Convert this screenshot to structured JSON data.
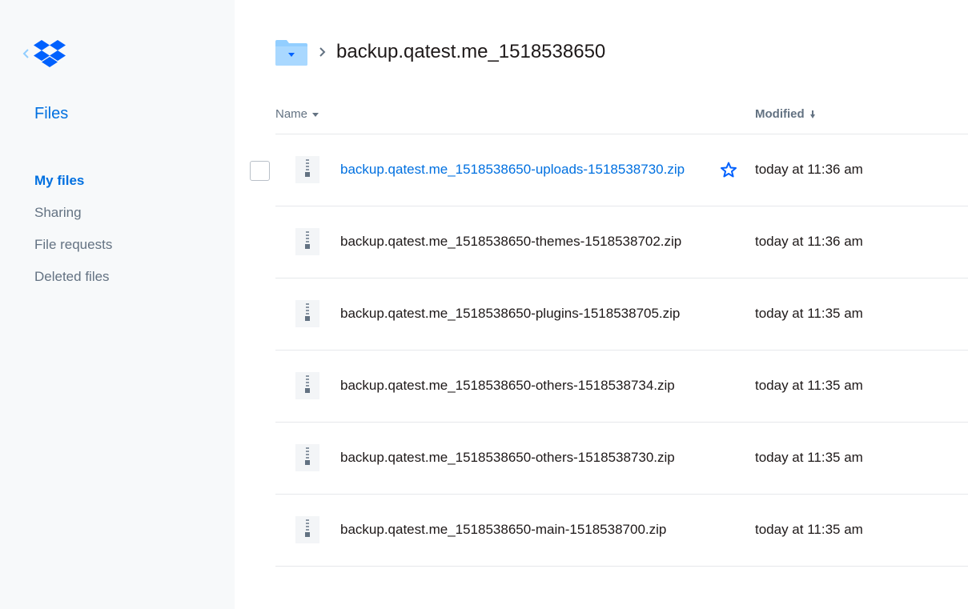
{
  "sidebar": {
    "title": "Files",
    "nav": [
      {
        "label": "My files",
        "active": true
      },
      {
        "label": "Sharing",
        "active": false
      },
      {
        "label": "File requests",
        "active": false
      },
      {
        "label": "Deleted files",
        "active": false
      }
    ]
  },
  "breadcrumb": {
    "folder_icon": "folder-icon",
    "current": "backup.qatest.me_1518538650"
  },
  "table": {
    "col_name": "Name",
    "col_modified": "Modified",
    "files": [
      {
        "name": "backup.qatest.me_1518538650-uploads-1518538730.zip",
        "modified": "today at 11:36 am",
        "hover": true
      },
      {
        "name": "backup.qatest.me_1518538650-themes-1518538702.zip",
        "modified": "today at 11:36 am",
        "hover": false
      },
      {
        "name": "backup.qatest.me_1518538650-plugins-1518538705.zip",
        "modified": "today at 11:35 am",
        "hover": false
      },
      {
        "name": "backup.qatest.me_1518538650-others-1518538734.zip",
        "modified": "today at 11:35 am",
        "hover": false
      },
      {
        "name": "backup.qatest.me_1518538650-others-1518538730.zip",
        "modified": "today at 11:35 am",
        "hover": false
      },
      {
        "name": "backup.qatest.me_1518538650-main-1518538700.zip",
        "modified": "today at 11:35 am",
        "hover": false
      }
    ]
  },
  "colors": {
    "accent": "#0070e0",
    "sidebar_bg": "#f7f9fa",
    "muted_text": "#637282",
    "folder": "#92ceff"
  }
}
